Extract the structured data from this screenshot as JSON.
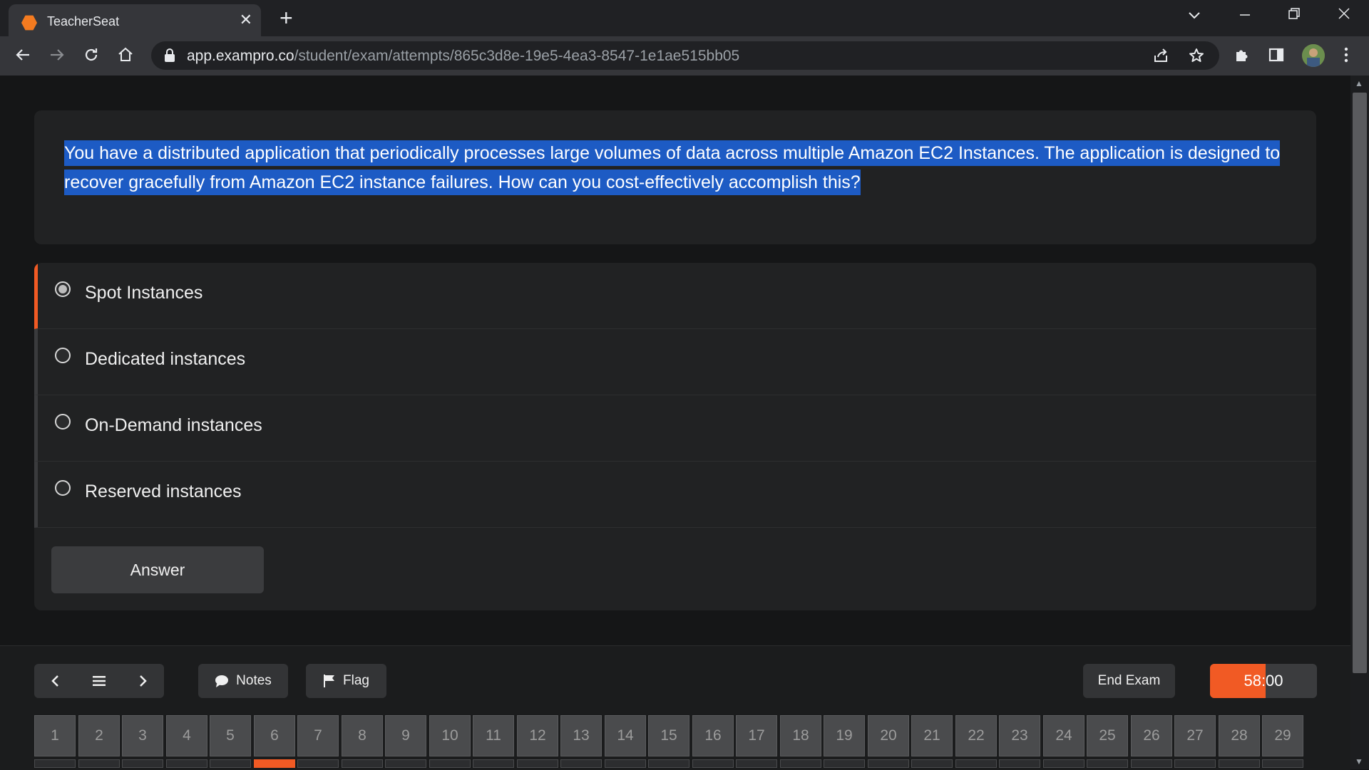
{
  "browser": {
    "tab_title": "TeacherSeat",
    "tab_close": "✕",
    "new_tab": "+",
    "url_host": "app.exampro.co",
    "url_path": "/student/exam/attempts/865c3d8e-19e5-4ea3-8547-1e1ae515bb05",
    "icons": [
      "back-icon",
      "forward-icon",
      "reload-icon",
      "home-icon",
      "lock-icon",
      "share-icon",
      "star-icon",
      "extensions-icon",
      "sidepanel-icon",
      "avatar",
      "menu-icon"
    ]
  },
  "question": {
    "text": "You have a distributed application that periodically processes large volumes of data across multiple Amazon EC2 Instances. The application is designed to recover gracefully from Amazon EC2 instance failures. How can you cost-effectively accomplish this?"
  },
  "options": [
    {
      "label": "Spot Instances",
      "selected": true
    },
    {
      "label": "Dedicated instances",
      "selected": false
    },
    {
      "label": "On-Demand instances",
      "selected": false
    },
    {
      "label": "Reserved instances",
      "selected": false
    }
  ],
  "answer_button": "Answer",
  "bottom_bar": {
    "notes_label": "Notes",
    "flag_label": "Flag",
    "end_exam_label": "End Exam",
    "timer": "58:00",
    "timer_progress": 0.52,
    "current_question": 6,
    "questions": [
      "1",
      "2",
      "3",
      "4",
      "5",
      "6",
      "7",
      "8",
      "9",
      "10",
      "11",
      "12",
      "13",
      "14",
      "15",
      "16",
      "17",
      "18",
      "19",
      "20",
      "21",
      "22",
      "23",
      "24",
      "25",
      "26",
      "27",
      "28",
      "29"
    ]
  },
  "colors": {
    "accent": "#f15a24",
    "selection": "#1d5bc4",
    "card": "#212223",
    "background": "#151617"
  }
}
